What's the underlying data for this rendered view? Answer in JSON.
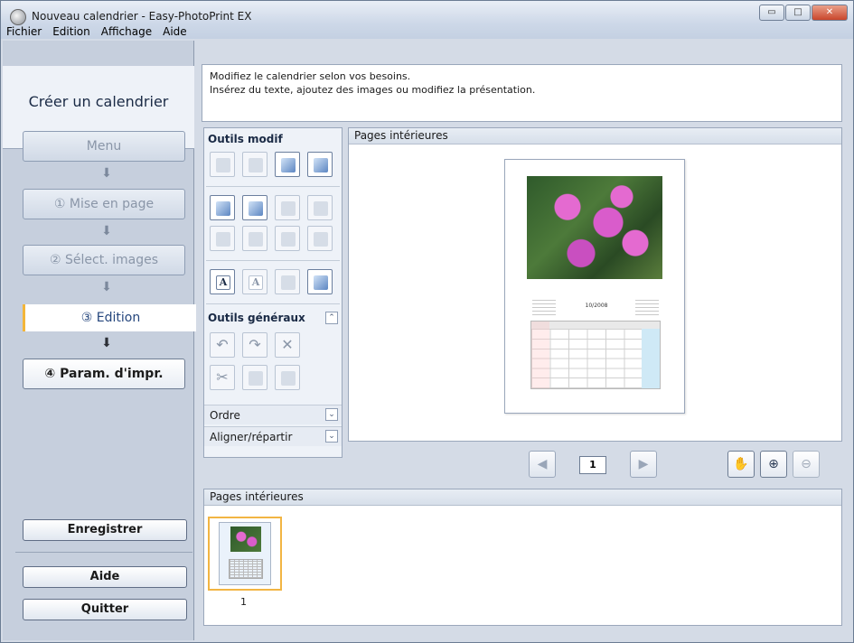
{
  "window": {
    "title": "Nouveau calendrier - Easy-PhotoPrint EX",
    "min_glyph": "▭",
    "max_glyph": "□",
    "close_glyph": "✕"
  },
  "menu": [
    "Fichier",
    "Edition",
    "Affichage",
    "Aide"
  ],
  "left": {
    "heading": "Créer un calendrier",
    "steps": [
      {
        "label": "Menu"
      },
      {
        "label": "① Mise en page"
      },
      {
        "label": "② Sélect. images"
      },
      {
        "label": "③ Edition"
      },
      {
        "label": "④ Param. d'impr."
      }
    ],
    "arrow_glyph": "⬇",
    "save_label": "Enregistrer",
    "help_label": "Aide",
    "quit_label": "Quitter"
  },
  "instructions": {
    "line1": "Modifiez le calendrier selon vos besoins.",
    "line2": "Insérez du texte, ajoutez des images ou modifiez la présentation."
  },
  "tools": {
    "edit_title": "Outils modif",
    "general_title": "Outils généraux",
    "collapse_up": "⌃",
    "collapse_down": "⌄",
    "order_label": "Ordre",
    "align_label": "Aligner/répartir",
    "text_glyph_1": "A",
    "text_glyph_2": "A",
    "undo_glyph": "↶",
    "redo_glyph": "↷",
    "delete_glyph": "✕",
    "cut_glyph": "✂"
  },
  "preview": {
    "header": "Pages intérieures",
    "calendar_month": "10/2008"
  },
  "nav": {
    "prev_glyph": "◀",
    "next_glyph": "▶",
    "page_number": "1",
    "hand_glyph": "✋",
    "zoom_in_glyph": "⊕",
    "zoom_out_glyph": "⊖"
  },
  "thumbnails": {
    "header": "Pages intérieures",
    "items": [
      {
        "label": "1"
      }
    ]
  }
}
